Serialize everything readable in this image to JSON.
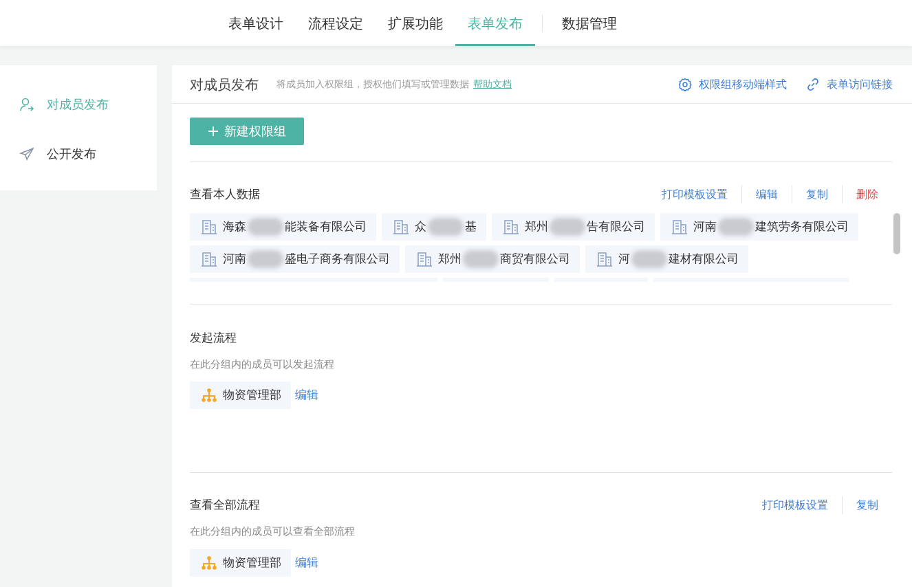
{
  "nav_tabs": [
    {
      "label": "表单设计",
      "selected": false
    },
    {
      "label": "流程设定",
      "selected": false
    },
    {
      "label": "扩展功能",
      "selected": false
    },
    {
      "label": "表单发布",
      "selected": true
    },
    {
      "label": "数据管理",
      "selected": false,
      "separated": true
    }
  ],
  "sidebar": {
    "items": [
      {
        "label": "对成员发布",
        "kind": "member",
        "selected": true
      },
      {
        "label": "公开发布",
        "kind": "send",
        "selected": false
      }
    ]
  },
  "header": {
    "title": "对成员发布",
    "hint": "将成员加入权限组，授权他们填写或管理数据",
    "help_link": "帮助文档",
    "actions": [
      {
        "label": "权限组移动端样式",
        "kind": "gear"
      },
      {
        "label": "表单访问链接",
        "kind": "link"
      }
    ]
  },
  "new_group_button": "新建权限组",
  "groups": [
    {
      "title": "查看本人数据",
      "actions": [
        {
          "label": "打印模板设置",
          "danger": false
        },
        {
          "label": "编辑",
          "danger": false
        },
        {
          "label": "复制",
          "danger": false
        },
        {
          "label": "删除",
          "danger": true
        }
      ],
      "scroll": true,
      "members": [
        {
          "kind": "company",
          "prefix": "海森",
          "suffix": "能装备有限公司"
        },
        {
          "kind": "company",
          "prefix": "众",
          "suffix": "基"
        },
        {
          "kind": "company",
          "prefix": "郑州",
          "suffix": "告有限公司"
        },
        {
          "kind": "company",
          "prefix": "河南",
          "suffix": "建筑劳务有限公司"
        },
        {
          "kind": "company",
          "prefix": "河南",
          "suffix": "盛电子商务有限公司"
        },
        {
          "kind": "company",
          "prefix": "郑州",
          "suffix": "商贸有限公司"
        },
        {
          "kind": "company",
          "prefix": "河",
          "suffix": "建材有限公司"
        }
      ]
    },
    {
      "title": "发起流程",
      "description": "在此分组内的成员可以发起流程",
      "members": [
        {
          "kind": "department",
          "name": "物资管理部"
        }
      ],
      "edit": "编辑"
    },
    {
      "title": "查看全部流程",
      "description": "在此分组内的成员可以查看全部流程",
      "actions": [
        {
          "label": "打印模板设置",
          "danger": false
        },
        {
          "label": "复制",
          "danger": false
        }
      ],
      "members": [
        {
          "kind": "department",
          "name": "物资管理部"
        }
      ],
      "edit": "编辑"
    }
  ]
}
